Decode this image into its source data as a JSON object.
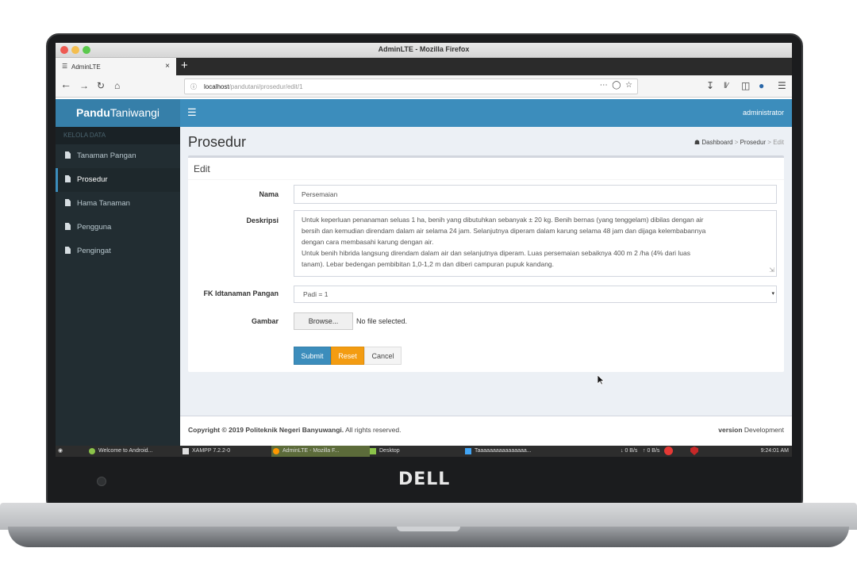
{
  "window": {
    "title": "AdminLTE - Mozilla Firefox"
  },
  "browser": {
    "tab_label": "AdminLTE",
    "url_host": "localhost",
    "url_path": "/pandutani/prosedur/edit/1"
  },
  "header": {
    "brand_bold": "Pandu",
    "brand_light": "Taniwangi",
    "user": "administrator"
  },
  "sidebar": {
    "section": "KELOLA DATA",
    "items": [
      {
        "label": "Tanaman Pangan"
      },
      {
        "label": "Prosedur"
      },
      {
        "label": "Hama Tanaman"
      },
      {
        "label": "Pengguna"
      },
      {
        "label": "Pengingat"
      }
    ]
  },
  "page": {
    "title": "Prosedur",
    "breadcrumb": [
      "Dashboard",
      "Prosedur",
      "Edit"
    ],
    "box_title": "Edit"
  },
  "form": {
    "nama_label": "Nama",
    "nama_value": "Persemaian",
    "deskripsi_label": "Deskripsi",
    "deskripsi_lines": [
      "Untuk keperluan penanaman seluas 1 ha, benih yang dibutuhkan sebanyak ± 20 kg. Benih bernas (yang tenggelam) dibilas dengan air",
      "bersih dan kemudian direndam dalam air selama 24 jam. Selanjutnya diperam dalam karung selama 48 jam dan dijaga kelembabannya",
      "dengan cara membasahi karung dengan air.",
      "Untuk benih hibrida langsung direndam dalam air dan selanjutnya diperam. Luas persemaian sebaiknya 400 m 2 /ha (4% dari luas",
      "tanam). Lebar bedengan pembibitan 1,0-1,2 m dan diberi campuran pupuk kandang."
    ],
    "fk_label": "FK Idtanaman Pangan",
    "fk_value": "Padi = 1",
    "gambar_label": "Gambar",
    "browse_label": "Browse...",
    "file_status": "No file selected.",
    "submit": "Submit",
    "reset": "Reset",
    "cancel": "Cancel"
  },
  "footer": {
    "copyright_bold": "Copyright © 2019 Politeknik Negeri Banyuwangi.",
    "copyright_rest": "All rights reserved.",
    "version_bold": "version",
    "version_value": "Development"
  },
  "taskbar": {
    "items": [
      "Welcome to Android...",
      "XAMPP 7.2.2-0",
      "AdminLTE - Mozilla F...",
      "Desktop",
      "Taaaaaaaaaaaaaaaa..."
    ],
    "net_down": "0 B/s",
    "net_up": "0 B/s",
    "clock": "9:24:01 AM"
  },
  "device": {
    "brand": "DELL"
  },
  "colors": {
    "primary": "#3c8dbc",
    "warning": "#f39c12",
    "sidebar": "#222d32"
  }
}
